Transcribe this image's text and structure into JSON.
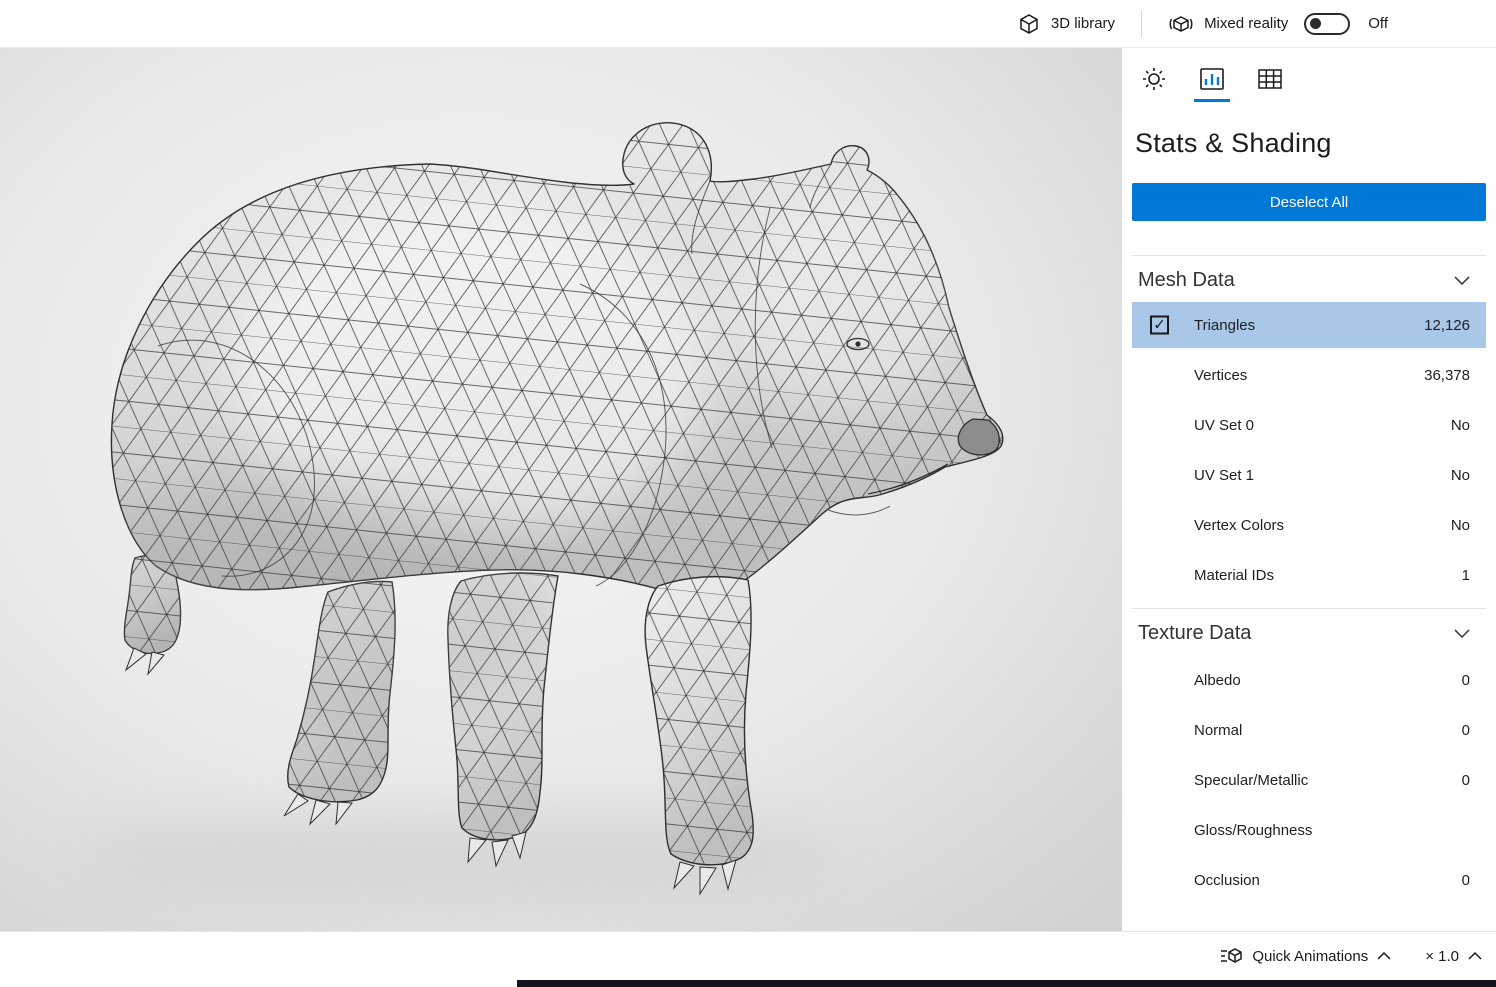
{
  "topbar": {
    "library": "3D library",
    "mixed_reality": "Mixed reality",
    "toggle_state": "Off"
  },
  "panel": {
    "title": "Stats & Shading",
    "deselect": "Deselect All",
    "mesh": {
      "title": "Mesh Data",
      "rows": [
        {
          "label": "Triangles",
          "value": "12,126"
        },
        {
          "label": "Vertices",
          "value": "36,378"
        },
        {
          "label": "UV Set 0",
          "value": "No"
        },
        {
          "label": "UV Set 1",
          "value": "No"
        },
        {
          "label": "Vertex Colors",
          "value": "No"
        },
        {
          "label": "Material IDs",
          "value": "1"
        }
      ]
    },
    "texture": {
      "title": "Texture Data",
      "rows": [
        {
          "label": "Albedo",
          "value": "0"
        },
        {
          "label": "Normal",
          "value": "0"
        },
        {
          "label": "Specular/Metallic",
          "value": "0"
        },
        {
          "label": "Gloss/Roughness",
          "value": ""
        },
        {
          "label": "Occlusion",
          "value": "0"
        }
      ]
    }
  },
  "bottombar": {
    "quick_animations": "Quick Animations",
    "speed": "× 1.0"
  },
  "icons": {
    "checkmark": "✓"
  },
  "colors": {
    "accent": "#0078d7",
    "selected_row": "#a9c7e8"
  }
}
